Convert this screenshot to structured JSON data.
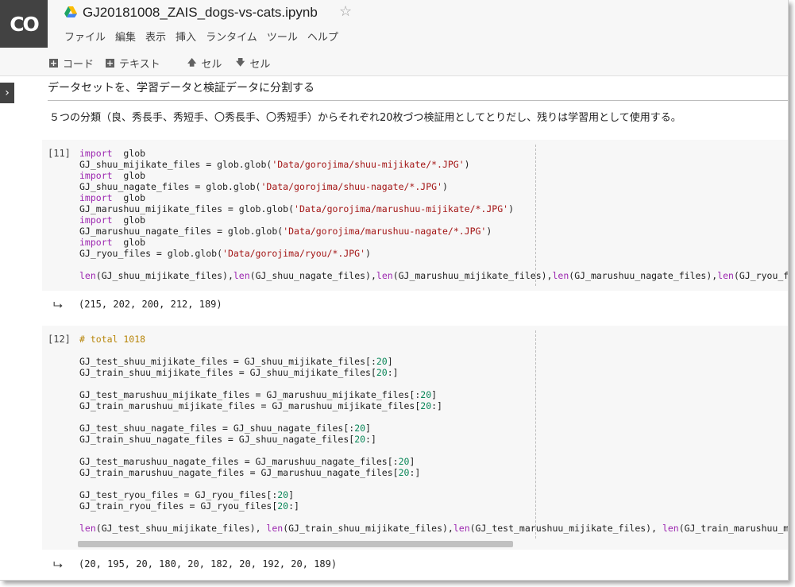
{
  "app": {
    "logo_text": "CO",
    "notebook_title": "GJ20181008_ZAIS_dogs-vs-cats.ipynb"
  },
  "menu": [
    "ファイル",
    "編集",
    "表示",
    "挿入",
    "ランタイム",
    "ツール",
    "ヘルプ"
  ],
  "toolbar": {
    "code_label": "コード",
    "text_label": "テキスト",
    "cell_up_label": "セル",
    "cell_down_label": "セル"
  },
  "text_cells": {
    "heading": "データセットを、学習データと検証データに分割する",
    "description": "５つの分類（良、秀長手、秀短手、〇秀長手、〇秀短手）からそれぞれ20枚づつ検証用としてとりだし、残りは学習用として使用する。"
  },
  "cell11": {
    "exec_count": "[11]",
    "lines": [
      [
        [
          "kw",
          "import"
        ],
        [
          "",
          "  glob"
        ]
      ],
      [
        [
          "",
          "GJ_shuu_mijikate_files = glob.glob("
        ],
        [
          "str",
          "'Data/gorojima/shuu-mijikate/*.JPG'"
        ],
        [
          "",
          ")"
        ]
      ],
      [
        [
          "kw",
          "import"
        ],
        [
          "",
          "  glob"
        ]
      ],
      [
        [
          "",
          "GJ_shuu_nagate_files = glob.glob("
        ],
        [
          "str",
          "'Data/gorojima/shuu-nagate/*.JPG'"
        ],
        [
          "",
          ")"
        ]
      ],
      [
        [
          "kw",
          "import"
        ],
        [
          "",
          "  glob"
        ]
      ],
      [
        [
          "",
          "GJ_marushuu_mijikate_files = glob.glob("
        ],
        [
          "str",
          "'Data/gorojima/marushuu-mijikate/*.JPG'"
        ],
        [
          "",
          ")"
        ]
      ],
      [
        [
          "kw",
          "import"
        ],
        [
          "",
          "  glob"
        ]
      ],
      [
        [
          "",
          "GJ_marushuu_nagate_files = glob.glob("
        ],
        [
          "str",
          "'Data/gorojima/marushuu-nagate/*.JPG'"
        ],
        [
          "",
          ")"
        ]
      ],
      [
        [
          "kw",
          "import"
        ],
        [
          "",
          "  glob"
        ]
      ],
      [
        [
          "",
          "GJ_ryou_files = glob.glob("
        ],
        [
          "str",
          "'Data/gorojima/ryou/*.JPG'"
        ],
        [
          "",
          ")"
        ]
      ],
      [],
      [
        [
          "kw",
          "len"
        ],
        [
          "",
          "(GJ_shuu_mijikate_files),"
        ],
        [
          "kw",
          "len"
        ],
        [
          "",
          "(GJ_shuu_nagate_files),"
        ],
        [
          "kw",
          "len"
        ],
        [
          "",
          "(GJ_marushuu_mijikate_files),"
        ],
        [
          "kw",
          "len"
        ],
        [
          "",
          "(GJ_marushuu_nagate_files),"
        ],
        [
          "kw",
          "len"
        ],
        [
          "",
          "(GJ_ryou_files)"
        ]
      ]
    ],
    "output": "(215, 202, 200, 212, 189)"
  },
  "cell12": {
    "exec_count": "[12]",
    "lines": [
      [
        [
          "cmt",
          "# total 1018"
        ]
      ],
      [],
      [
        [
          "",
          "GJ_test_shuu_mijikate_files = GJ_shuu_mijikate_files[:"
        ],
        [
          "num",
          "20"
        ],
        [
          "",
          "]"
        ]
      ],
      [
        [
          "",
          "GJ_train_shuu_mijikate_files = GJ_shuu_mijikate_files["
        ],
        [
          "num",
          "20"
        ],
        [
          "",
          ":]"
        ]
      ],
      [],
      [
        [
          "",
          "GJ_test_marushuu_mijikate_files = GJ_marushuu_mijikate_files[:"
        ],
        [
          "num",
          "20"
        ],
        [
          "",
          "]"
        ]
      ],
      [
        [
          "",
          "GJ_train_marushuu_mijikate_files = GJ_marushuu_mijikate_files["
        ],
        [
          "num",
          "20"
        ],
        [
          "",
          ":]"
        ]
      ],
      [],
      [
        [
          "",
          "GJ_test_shuu_nagate_files = GJ_shuu_nagate_files[:"
        ],
        [
          "num",
          "20"
        ],
        [
          "",
          "]"
        ]
      ],
      [
        [
          "",
          "GJ_train_shuu_nagate_files = GJ_shuu_nagate_files["
        ],
        [
          "num",
          "20"
        ],
        [
          "",
          ":]"
        ]
      ],
      [],
      [
        [
          "",
          "GJ_test_marushuu_nagate_files = GJ_marushuu_nagate_files[:"
        ],
        [
          "num",
          "20"
        ],
        [
          "",
          "]"
        ]
      ],
      [
        [
          "",
          "GJ_train_marushuu_nagate_files = GJ_marushuu_nagate_files["
        ],
        [
          "num",
          "20"
        ],
        [
          "",
          ":]"
        ]
      ],
      [],
      [
        [
          "",
          "GJ_test_ryou_files = GJ_ryou_files[:"
        ],
        [
          "num",
          "20"
        ],
        [
          "",
          "]"
        ]
      ],
      [
        [
          "",
          "GJ_train_ryou_files = GJ_ryou_files["
        ],
        [
          "num",
          "20"
        ],
        [
          "",
          ":]"
        ]
      ],
      [],
      [
        [
          "kw",
          "len"
        ],
        [
          "",
          "(GJ_test_shuu_mijikate_files), "
        ],
        [
          "kw",
          "len"
        ],
        [
          "",
          "(GJ_train_shuu_mijikate_files),"
        ],
        [
          "kw",
          "len"
        ],
        [
          "",
          "(GJ_test_marushuu_mijikate_files), "
        ],
        [
          "kw",
          "len"
        ],
        [
          "",
          "(GJ_train_marushuu_mijikate_"
        ]
      ]
    ],
    "output": "(20, 195, 20, 180, 20, 182, 20, 192, 20, 189)"
  }
}
